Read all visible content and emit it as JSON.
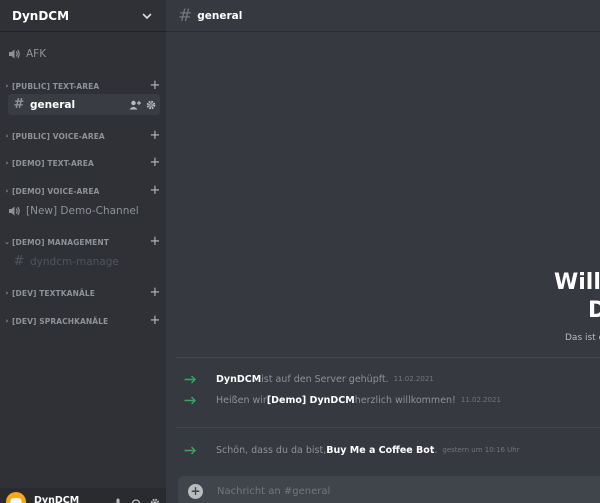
{
  "server": {
    "name": "DynDCM"
  },
  "sidebar": {
    "afk": "AFK",
    "categories": [
      {
        "label": "[PUBLIC] TEXT-AREA"
      },
      {
        "label": "[PUBLIC] VOICE-AREA"
      },
      {
        "label": "[DEMO] TEXT-AREA"
      },
      {
        "label": "[DEMO] VOICE-AREA"
      },
      {
        "label": "[DEMO] MANAGEMENT"
      },
      {
        "label": "[DEV] TEXTKANÄLE"
      },
      {
        "label": "[DEV] SPRACHKANÄLE"
      }
    ],
    "general": "general",
    "demo_voice_channel": "[New] Demo-Channel",
    "manage_channel": "dyndcm-manage"
  },
  "user": {
    "name": "DynDCM"
  },
  "channel": {
    "name": "general"
  },
  "welcome": {
    "title_partial": "Willk",
    "title_partial_2": "D",
    "subtitle_partial": "Das ist d"
  },
  "messages": [
    {
      "user": "DynDCM",
      "text": " ist auf den Server gehüpft.",
      "time": "11.02.2021"
    },
    {
      "pre": "Heißen wir ",
      "user": "[Demo] DynDCM",
      "text": " herzlich willkommen!",
      "time": "11.02.2021"
    },
    {
      "pre": "Schön, dass du da bist, ",
      "user": "Buy Me a Coffee Bot",
      "text": ".",
      "time": "gestern um 10:16 Uhr"
    }
  ],
  "composer": {
    "placeholder": "Nachricht an #general"
  },
  "colors": {
    "accent_green": "#3ba55c",
    "avatar": "#faa61a",
    "sidebar_bg": "#2f3136",
    "main_bg": "#36393f"
  }
}
